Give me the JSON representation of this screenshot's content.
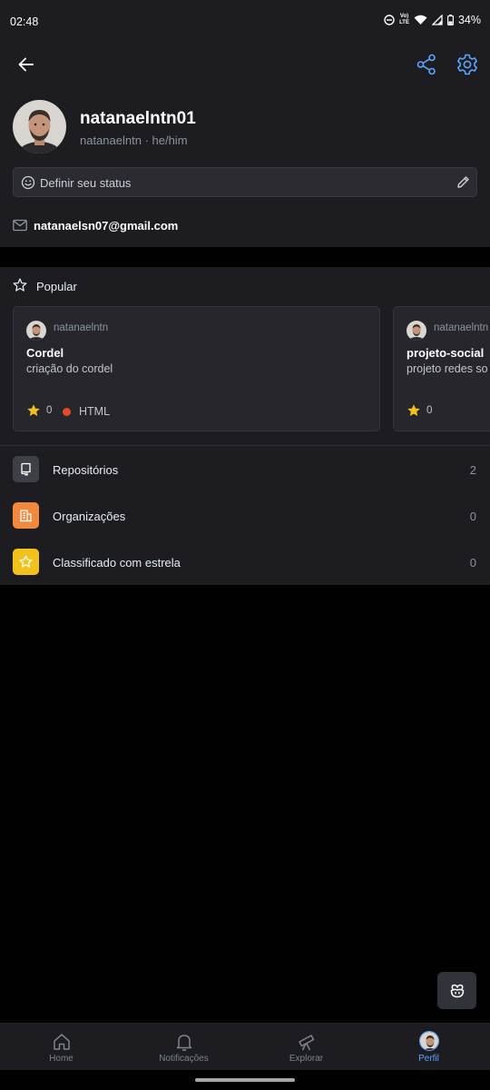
{
  "status_bar": {
    "time": "02:48",
    "volte_line1": "Vo)",
    "volte_line2": "LTE",
    "battery": "34%"
  },
  "profile": {
    "display_name": "natanaelntn01",
    "subtitle": "natanaelntn · he/him",
    "status_placeholder": "Definir seu status",
    "email": "natanaelsn07@gmail.com"
  },
  "popular": {
    "title": "Popular",
    "repos": [
      {
        "owner": "natanaelntn",
        "name": "Cordel",
        "description": "criação do cordel",
        "stars": "0",
        "language": "HTML",
        "language_color": "#e34c26"
      },
      {
        "owner": "natanaelntn",
        "name": "projeto-social",
        "description": "projeto redes so",
        "stars": "0"
      }
    ]
  },
  "menu": [
    {
      "label": "Repositórios",
      "count": "2",
      "icon": "repo-icon",
      "color": "#3d4047"
    },
    {
      "label": "Organizações",
      "count": "0",
      "icon": "organization-icon",
      "color": "#f0883e"
    },
    {
      "label": "Classificado com estrela",
      "count": "0",
      "icon": "star-icon",
      "color": "#f1c21b"
    }
  ],
  "bottom_nav": {
    "items": [
      {
        "label": "Home",
        "icon": "home-icon"
      },
      {
        "label": "Notificações",
        "icon": "bell-icon"
      },
      {
        "label": "Explorar",
        "icon": "telescope-icon"
      },
      {
        "label": "Perfil",
        "icon": "avatar"
      }
    ],
    "active": "Perfil"
  },
  "colors": {
    "accent": "#58a6ff",
    "background": "#1c1c21",
    "star": "#f1c21b"
  }
}
